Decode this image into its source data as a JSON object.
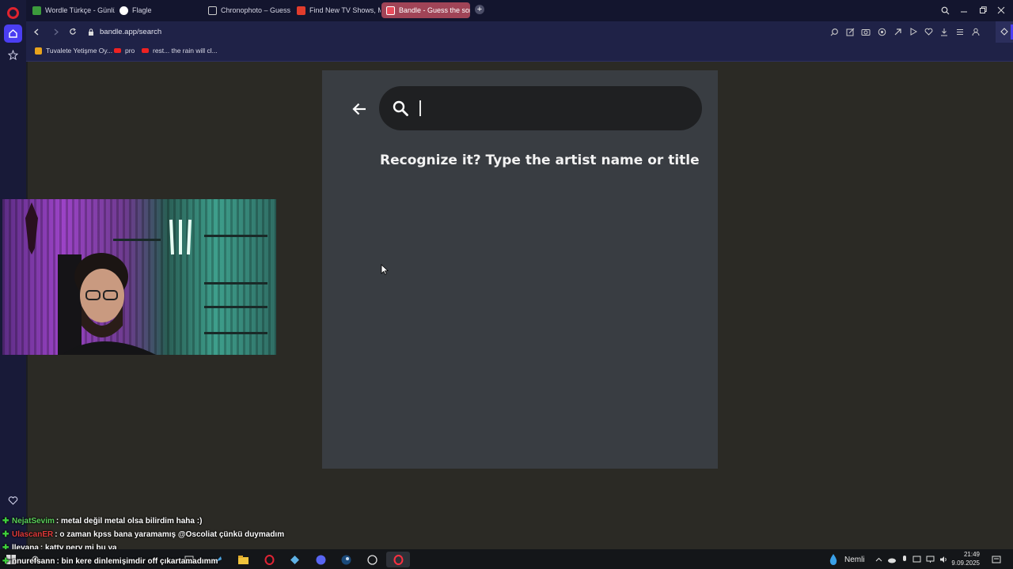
{
  "browser": {
    "tabs": [
      {
        "title": "Wordle Türkçe - Günlük K",
        "color": "#3c9b3c",
        "letter": "W",
        "active": false
      },
      {
        "title": "Flagle",
        "color": "#ffffff",
        "letter": "",
        "active": false
      },
      {
        "title": "Chronophoto – Guess the",
        "color": "#cccccc",
        "letter": "",
        "active": false
      },
      {
        "title": "Find New TV Shows, Mov",
        "color": "#e23c2c",
        "letter": "L",
        "active": false
      },
      {
        "title": "Bandle - Guess the song,",
        "color": "#e84c5c",
        "letter": "B",
        "active": true
      }
    ],
    "url": "bandle.app/search",
    "bookmarks": [
      {
        "label": "Tuvalete Yetişme Oy...",
        "icon": "trophy-icon"
      },
      {
        "label": "pro",
        "icon": "youtube-icon"
      },
      {
        "label": "rest... the rain will cl...",
        "icon": "youtube-icon"
      }
    ],
    "accent": "#4b3ef2"
  },
  "bandle": {
    "search_placeholder": "",
    "prompt": "Recognize it? Type the artist name or title"
  },
  "chat": [
    {
      "user": "NejatSevim",
      "user_color": "green",
      "message": " : metal değil metal olsa bilirdim haha :)"
    },
    {
      "user": "UlascanER",
      "user_color": "red",
      "message": " : o zaman kpss bana yaramamış @Oscoliat çünkü duymadım"
    },
    {
      "user": "llevana",
      "user_color": "plain",
      "message": " : katty pery mi bu ya"
    },
    {
      "user": "nnurefsann",
      "user_color": "plain",
      "message": " : bin kere dinlemişimdir off çıkartamadımm"
    }
  ],
  "taskbar": {
    "weather": "Nemli",
    "time": "21:49",
    "date": "9.09.2025"
  }
}
